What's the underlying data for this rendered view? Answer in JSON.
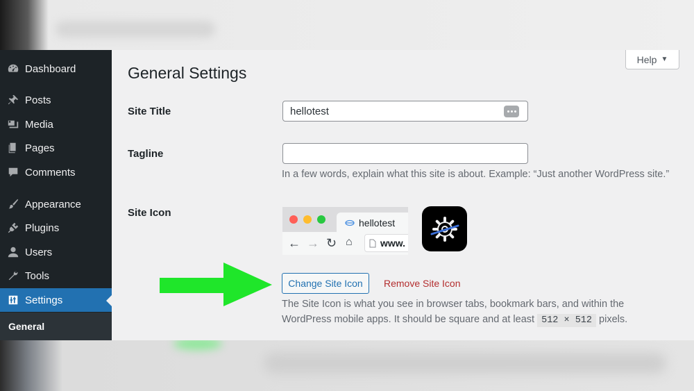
{
  "sidebar": {
    "items": [
      {
        "label": "Dashboard",
        "icon": "dashboard-icon"
      },
      {
        "label": "Posts",
        "icon": "pin-icon"
      },
      {
        "label": "Media",
        "icon": "media-icon"
      },
      {
        "label": "Pages",
        "icon": "pages-icon"
      },
      {
        "label": "Comments",
        "icon": "comment-icon"
      },
      {
        "label": "Appearance",
        "icon": "brush-icon"
      },
      {
        "label": "Plugins",
        "icon": "plug-icon"
      },
      {
        "label": "Users",
        "icon": "user-icon"
      },
      {
        "label": "Tools",
        "icon": "wrench-icon"
      },
      {
        "label": "Settings",
        "icon": "settings-sliders-icon",
        "active": true
      }
    ],
    "submenu": {
      "label": "General"
    },
    "active_color": "#2271b1",
    "background": "#1d2327"
  },
  "header": {
    "help_label": "Help",
    "page_title": "General Settings"
  },
  "form": {
    "site_title": {
      "label": "Site Title",
      "value": "hellotest"
    },
    "tagline": {
      "label": "Tagline",
      "value": "",
      "description": "In a few words, explain what this site is about. Example: “Just another WordPress site.”"
    },
    "site_icon": {
      "label": "Site Icon",
      "preview_tab_title": "hellotest",
      "preview_address": "www.",
      "change_button": "Change Site Icon",
      "remove_button": "Remove Site Icon",
      "description_1": "The Site Icon is what you see in browser tabs, bookmark bars, and within the",
      "description_2_before": "WordPress mobile apps. It should be square and at least",
      "size_code": "512 × 512",
      "description_2_after": "pixels."
    }
  },
  "annotation": {
    "arrow_color": "#1fe62a"
  }
}
